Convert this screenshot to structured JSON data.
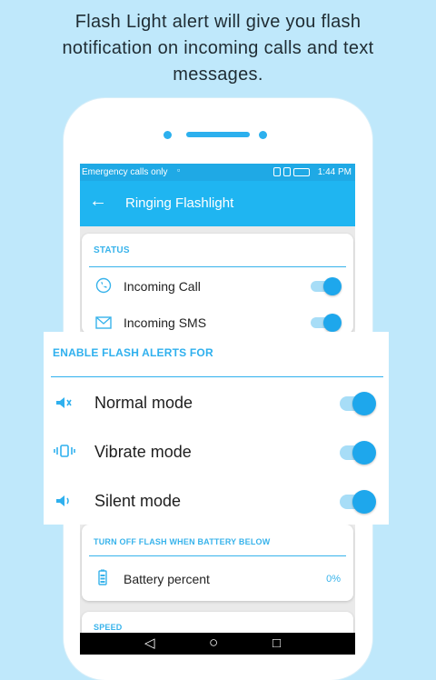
{
  "promo": {
    "headline_line1": "Flash Light alert will give you flash",
    "headline_line2": "notification on incoming calls and text",
    "headline_line3": "messages."
  },
  "statusbar": {
    "carrier": "Emergency calls only",
    "time": "1:44 PM"
  },
  "appbar": {
    "back_glyph": "←",
    "title": "Ringing Flashlight"
  },
  "status_section": {
    "label": "STATUS",
    "items": [
      {
        "label": "Incoming Call",
        "icon": "phone-icon",
        "enabled": true
      },
      {
        "label": "Incoming SMS",
        "icon": "message-icon",
        "enabled": true
      }
    ]
  },
  "flash_alerts": {
    "label": "ENABLE FLASH ALERTS FOR",
    "modes": [
      {
        "label": "Normal mode",
        "icon": "speaker-normal-icon",
        "enabled": true
      },
      {
        "label": "Vibrate mode",
        "icon": "vibrate-icon",
        "enabled": true
      },
      {
        "label": "Silent mode",
        "icon": "speaker-silent-icon",
        "enabled": true
      }
    ]
  },
  "battery_section": {
    "label": "TURN OFF FLASH WHEN BATTERY BELOW",
    "item_label": "Battery percent",
    "value": "0%"
  },
  "speed_section": {
    "label": "SPEED"
  },
  "navbar": {
    "back": "◁",
    "home": "○",
    "recents": "□"
  },
  "colors": {
    "background": "#bfe8fb",
    "accent": "#1fb5f1",
    "toggle_on": "#1ea7ec",
    "section_label": "#38b3eb"
  }
}
